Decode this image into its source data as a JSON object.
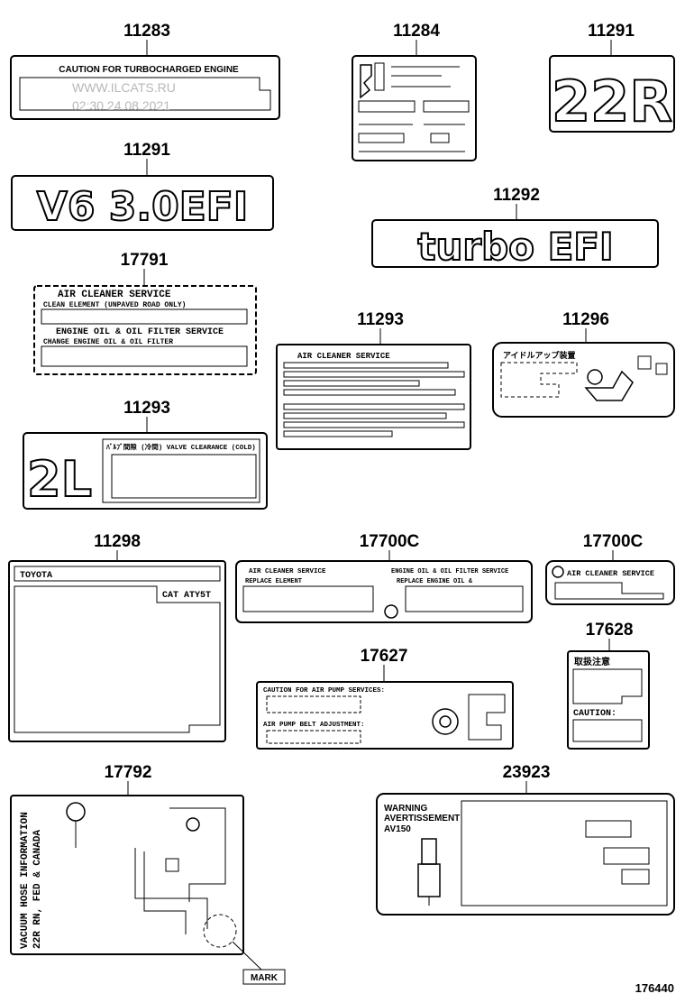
{
  "watermark": {
    "site": "WWW.ILCATS.RU",
    "timestamp": "02:30 24.08.2021"
  },
  "diagram_id": "176440",
  "parts": {
    "p11283": {
      "number": "11283",
      "text": "CAUTION FOR TURBOCHARGED ENGINE"
    },
    "p11284": {
      "number": "11284"
    },
    "p11291a": {
      "number": "11291",
      "text": "22R"
    },
    "p11291b": {
      "number": "11291",
      "text": "V6 3.0EFI"
    },
    "p11292": {
      "number": "11292",
      "text": "turbo EFI"
    },
    "p17791": {
      "number": "17791",
      "line1": "AIR  CLEANER  SERVICE",
      "line2": "CLEAN ELEMENT (UNPAVED ROAD ONLY)",
      "line3": "ENGINE OIL & OIL FILTER SERVICE",
      "line4": "CHANGE ENGINE OIL & OIL FILTER"
    },
    "p11293a": {
      "number": "11293",
      "title": "AIR  CLEANER  SERVICE"
    },
    "p11296": {
      "number": "11296",
      "text": "アイドルアップ装置"
    },
    "p11293b": {
      "number": "11293",
      "big": "2L",
      "text": "ﾊﾞﾙﾌﾞ間隙 (冷間) VALVE CLEARANCE (COLD)"
    },
    "p11298": {
      "number": "11298",
      "brand": "TOYOTA",
      "code": "CAT ATY5T"
    },
    "p17700c_a": {
      "number": "17700C",
      "left1": "AIR  CLEANER  SERVICE",
      "left2": "REPLACE ELEMENT",
      "right1": "ENGINE OIL & OIL FILTER SERVICE",
      "right2": "REPLACE ENGINE OIL &"
    },
    "p17700c_b": {
      "number": "17700C",
      "text": "AIR CLEANER  SERVICE"
    },
    "p17627": {
      "number": "17627",
      "line1": "CAUTION FOR AIR PUMP SERVICES:",
      "line2": "AIR PUMP BELT ADJUSTMENT:"
    },
    "p17628": {
      "number": "17628",
      "line1": "取扱注意",
      "line2": "CAUTION:"
    },
    "p17792": {
      "number": "17792",
      "v1": "VACUUM HOSE INFORMATION",
      "v2": "22R RN, FED & CANADA",
      "mark": "MARK"
    },
    "p23923": {
      "number": "23923",
      "w1": "WARNING",
      "w2": "AVERTISSEMENT",
      "w3": "AV150"
    }
  }
}
